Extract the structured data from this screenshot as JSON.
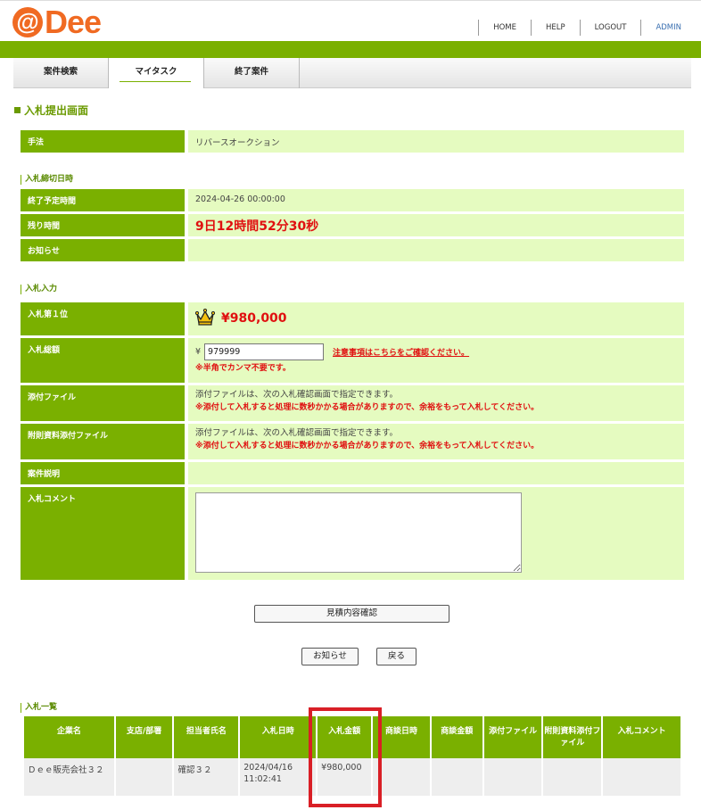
{
  "header": {
    "logo_at": "@",
    "logo_text": "Dee",
    "nav": [
      "HOME",
      "HELP",
      "LOGOUT",
      "ADMIN"
    ]
  },
  "tabs": [
    "案件検索",
    "マイタスク",
    "終了案件"
  ],
  "page_title": "入札提出画面",
  "method": {
    "label": "手法",
    "value": "リバースオークション"
  },
  "deadline_section": "入札締切日時",
  "end_time": {
    "label": "終了予定時間",
    "value": "2024-04-26 00:00:00"
  },
  "remaining": {
    "label": "残り時間",
    "value": "9日12時間52分30秒"
  },
  "notice": {
    "label": "お知らせ",
    "value": ""
  },
  "input_section": "入札入力",
  "rank1": {
    "label": "入札第１位",
    "value": "¥980,000"
  },
  "total": {
    "label": "入札総額",
    "yen": "¥",
    "input_value": "979999",
    "link": "注意事項はこちらをご確認ください。",
    "note": "※半角でカンマ不要です。"
  },
  "attach": {
    "label": "添付ファイル",
    "text": "添付ファイルは、次の入札確認画面で指定できます。",
    "note": "※添付して入札すると処理に数秒かかる場合がありますので、余裕をもって入札してください。"
  },
  "extra_attach": {
    "label": "附則資料添付ファイル",
    "text": "添付ファイルは、次の入札確認画面で指定できます。",
    "note": "※添付して入札すると処理に数秒かかる場合がありますので、余裕をもって入札してください。"
  },
  "case_desc": {
    "label": "案件説明",
    "value": ""
  },
  "comment": {
    "label": "入札コメント",
    "value": ""
  },
  "buttons": {
    "confirm": "見積内容確認",
    "notice": "お知らせ",
    "back": "戻る"
  },
  "list_section": "入札一覧",
  "table": {
    "headers": [
      "企業名",
      "支店/部署",
      "担当者氏名",
      "入札日時",
      "入札金額",
      "商談日時",
      "商談金額",
      "添付ファイル",
      "附則資料添付ファイル",
      "入札コメント"
    ],
    "row": {
      "company": "Ｄｅｅ販売会社３２",
      "branch": "",
      "person": "確認３２",
      "date": "2024/04/16",
      "time": "11:02:41",
      "amount": "¥980,000",
      "nego_date": "",
      "nego_amount": "",
      "attach": "",
      "extra": "",
      "comment": ""
    }
  },
  "colors": {
    "accent": "#7ab000",
    "light": "#e5fbc0",
    "logo": "#f06a22",
    "alert": "#e01010",
    "highlight": "#d91f26"
  }
}
